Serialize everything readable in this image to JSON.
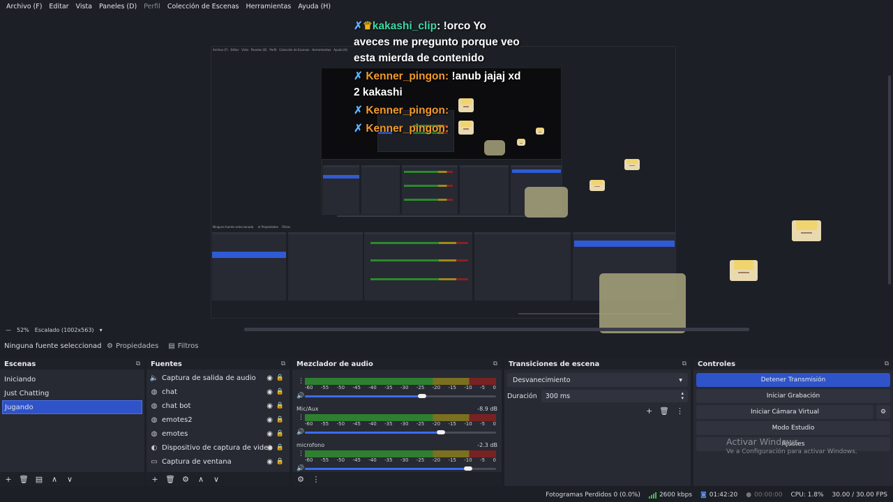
{
  "menu": [
    "Archivo (F)",
    "Editar",
    "Vista",
    "Paneles (D)",
    "Perfil",
    "Colección de Escenas",
    "Herramientas",
    "Ayuda (H)"
  ],
  "chat": [
    {
      "user": "kakashi_clip",
      "text": "!orco Yo aveces me pregunto porque veo esta mierda de contenido"
    },
    {
      "user": "Kenner_pingon",
      "text": "!anub jajaj xd 2 kakashi"
    },
    {
      "user": "Kenner_pingon",
      "text": ""
    },
    {
      "user": "Kenner_pingon",
      "text": ""
    }
  ],
  "preview_status": {
    "zoom": "52%",
    "scale": "Escalado (1002x563)"
  },
  "source_toolbar": {
    "no_source": "Ninguna fuente seleccionad",
    "properties": "Propiedades",
    "filters": "Filtros"
  },
  "scenes": {
    "title": "Escenas",
    "items": [
      "Iniciando",
      "Just Chatting",
      "Jugando"
    ],
    "selected": 2
  },
  "sources": {
    "title": "Fuentes",
    "items": [
      {
        "label": "Captura de salida de audio",
        "icon": "speaker-icon"
      },
      {
        "label": "chat",
        "icon": "globe-icon"
      },
      {
        "label": "chat bot",
        "icon": "globe-icon"
      },
      {
        "label": "emotes2",
        "icon": "globe-icon"
      },
      {
        "label": "emotes",
        "icon": "globe-icon"
      },
      {
        "label": "Dispositivo de captura de video",
        "icon": "camera-icon"
      },
      {
        "label": "Captura de ventana",
        "icon": "window-icon"
      }
    ]
  },
  "mixer": {
    "title": "Mezclador de audio",
    "ticks": [
      "-60",
      "-55",
      "-50",
      "-45",
      "-40",
      "-35",
      "-30",
      "-25",
      "-20",
      "-15",
      "-10",
      "-5",
      "0"
    ],
    "channels": [
      {
        "name": "",
        "db": "",
        "level": 0.62
      },
      {
        "name": "Mic/Aux",
        "db": "-8.9 dB",
        "level": 0.72
      },
      {
        "name": "microfono",
        "db": "-2.3 dB",
        "level": 0.87
      }
    ]
  },
  "transitions": {
    "title": "Transiciones de escena",
    "selected": "Desvanecimiento",
    "duration_label": "Duración",
    "duration_value": "300 ms"
  },
  "controls": {
    "title": "Controles",
    "stop_stream": "Detener Transmisión",
    "start_rec": "Iniciar Grabación",
    "virtual_cam": "Iniciar Cámara Virtual",
    "studio": "Modo Estudio",
    "settings": "Ajustes"
  },
  "watermark": {
    "line1": "Activar Windows",
    "line2": "Ve a Configuración para activar Windows."
  },
  "statusbar": {
    "dropped": "Fotogramas Perdidos 0 (0.0%)",
    "bitrate": "2600 kbps",
    "live_time": "01:42:20",
    "rec_time": "00:00:00",
    "cpu": "CPU: 1.8%",
    "fps": "30.00 / 30.00 FPS"
  },
  "colors": {
    "accent": "#2f53c9",
    "bg": "#1d1f26",
    "dock": "#272a33",
    "user1": "#3fd9a4",
    "user2": "#f29a2a"
  }
}
